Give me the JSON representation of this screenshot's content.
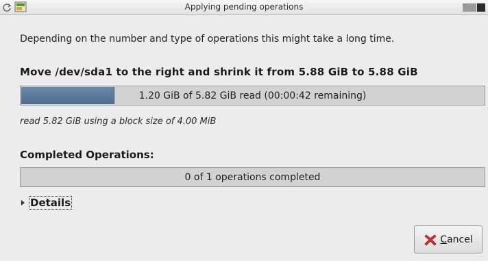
{
  "window": {
    "title": "Applying pending operations"
  },
  "dialog": {
    "description": "Depending on the number and type of operations this might take a long time.",
    "current_operation": "Move /dev/sda1 to the right and shrink it from 5.88 GiB to 5.88 GiB",
    "current_progress": {
      "fraction": 0.2,
      "text": "1.20 GiB of 5.82 GiB read (00:00:42 remaining)"
    },
    "read_info": "read 5.82 GiB using a block size of 4.00 MiB",
    "completed_heading": "Completed Operations:",
    "completed_progress": {
      "fraction": 0,
      "text": "0 of 1 operations completed"
    },
    "details_label": "Details",
    "cancel_button": {
      "mnemonic": "C",
      "rest": "ancel"
    }
  },
  "icons": {
    "window_menu": "refresh-icon",
    "app": "gparted-icon",
    "cancel": "cancel-icon"
  },
  "colors": {
    "progress_fill": "#4f6d8e",
    "cancel_icon": "#d93030"
  }
}
